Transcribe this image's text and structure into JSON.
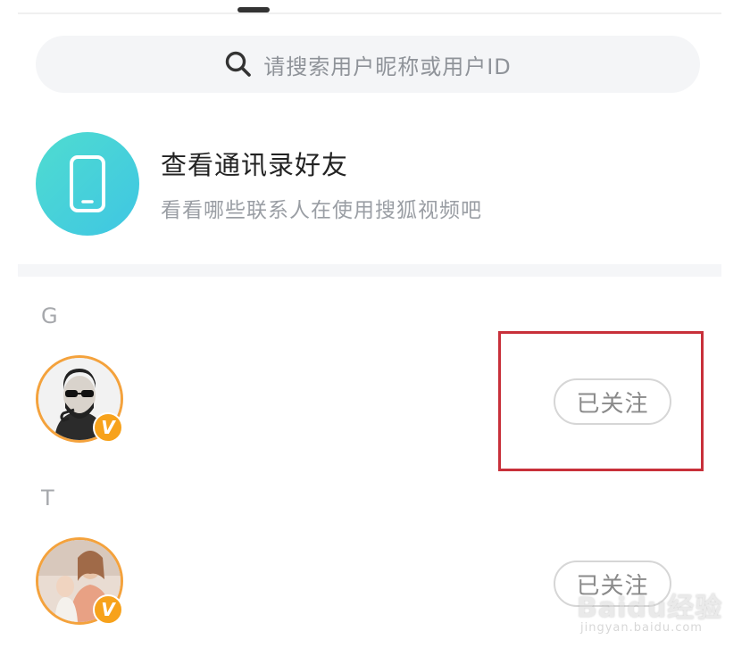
{
  "search": {
    "icon": "search-icon",
    "placeholder": "请搜索用户昵称或用户ID"
  },
  "contacts": {
    "icon": "phone-icon",
    "title": "查看通讯录好友",
    "subtitle": "看看哪些联系人在使用搜狐视频吧"
  },
  "sections": [
    {
      "letter": "G",
      "user": {
        "name": "",
        "badge": "V",
        "follow_label": "已关注"
      }
    },
    {
      "letter": "T",
      "user": {
        "name": "",
        "badge": "V",
        "follow_label": "已关注"
      }
    }
  ],
  "watermark": {
    "brand": "Baidu经验",
    "url": "jingyan.baidu.com"
  },
  "colors": {
    "accent_gradient_start": "#4fdcd0",
    "accent_gradient_end": "#3fc6e3",
    "avatar_ring": "#f4a23c",
    "badge": "#f7a21b",
    "highlight": "#c8303a"
  }
}
